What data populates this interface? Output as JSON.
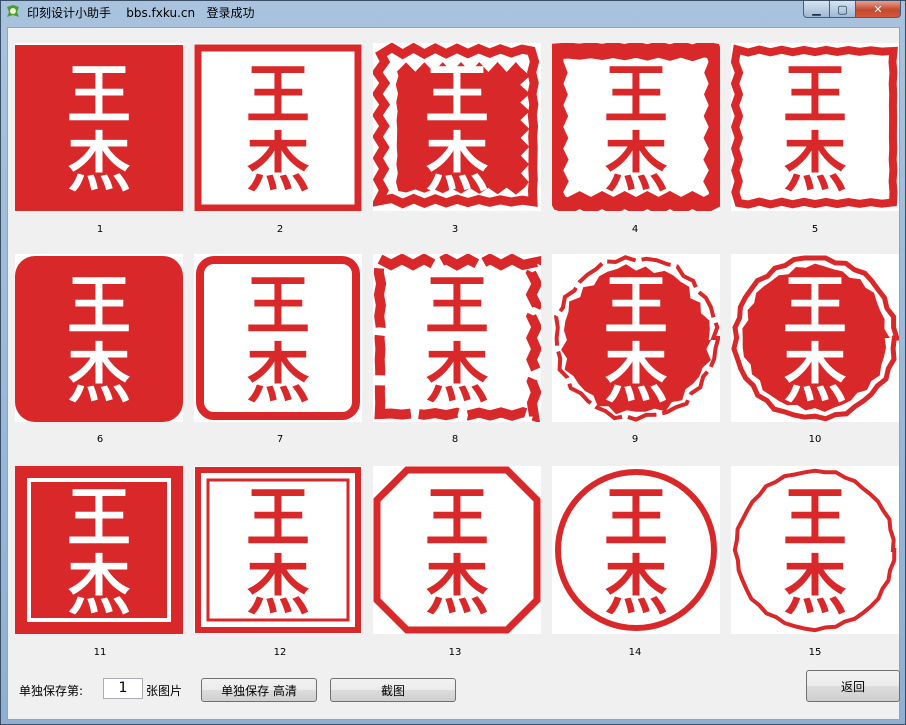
{
  "window": {
    "title": "印刻设计小助手    bbs.fxku.cn   登录成功",
    "minimize_glyph": "▁",
    "maximize_glyph": "▢",
    "close_glyph": "✕"
  },
  "seal": {
    "char_top": "王",
    "char_bottom": "杰",
    "color": "#d8282a"
  },
  "styles": [
    {
      "number": "1",
      "style": "solid-square"
    },
    {
      "number": "2",
      "style": "square-border"
    },
    {
      "number": "3",
      "style": "rough-solid-square"
    },
    {
      "number": "4",
      "style": "rough-border-square"
    },
    {
      "number": "5",
      "style": "thin-rough-border-square"
    },
    {
      "number": "6",
      "style": "solid-rounded-square"
    },
    {
      "number": "7",
      "style": "rounded-border-square"
    },
    {
      "number": "8",
      "style": "broken-border-square"
    },
    {
      "number": "9",
      "style": "rough-solid-circle"
    },
    {
      "number": "10",
      "style": "solid-circle-with-ring"
    },
    {
      "number": "11",
      "style": "solid-square-inner-frame"
    },
    {
      "number": "12",
      "style": "double-border-square"
    },
    {
      "number": "13",
      "style": "octagon-border"
    },
    {
      "number": "14",
      "style": "circle-border"
    },
    {
      "number": "15",
      "style": "thin-circle-border"
    }
  ],
  "footer": {
    "save_label": "单独保存第:",
    "page_value": "1",
    "page_suffix": "张图片",
    "save_hd_button": "单独保存 高清",
    "screenshot_button": "截图",
    "back_button": "返回"
  }
}
